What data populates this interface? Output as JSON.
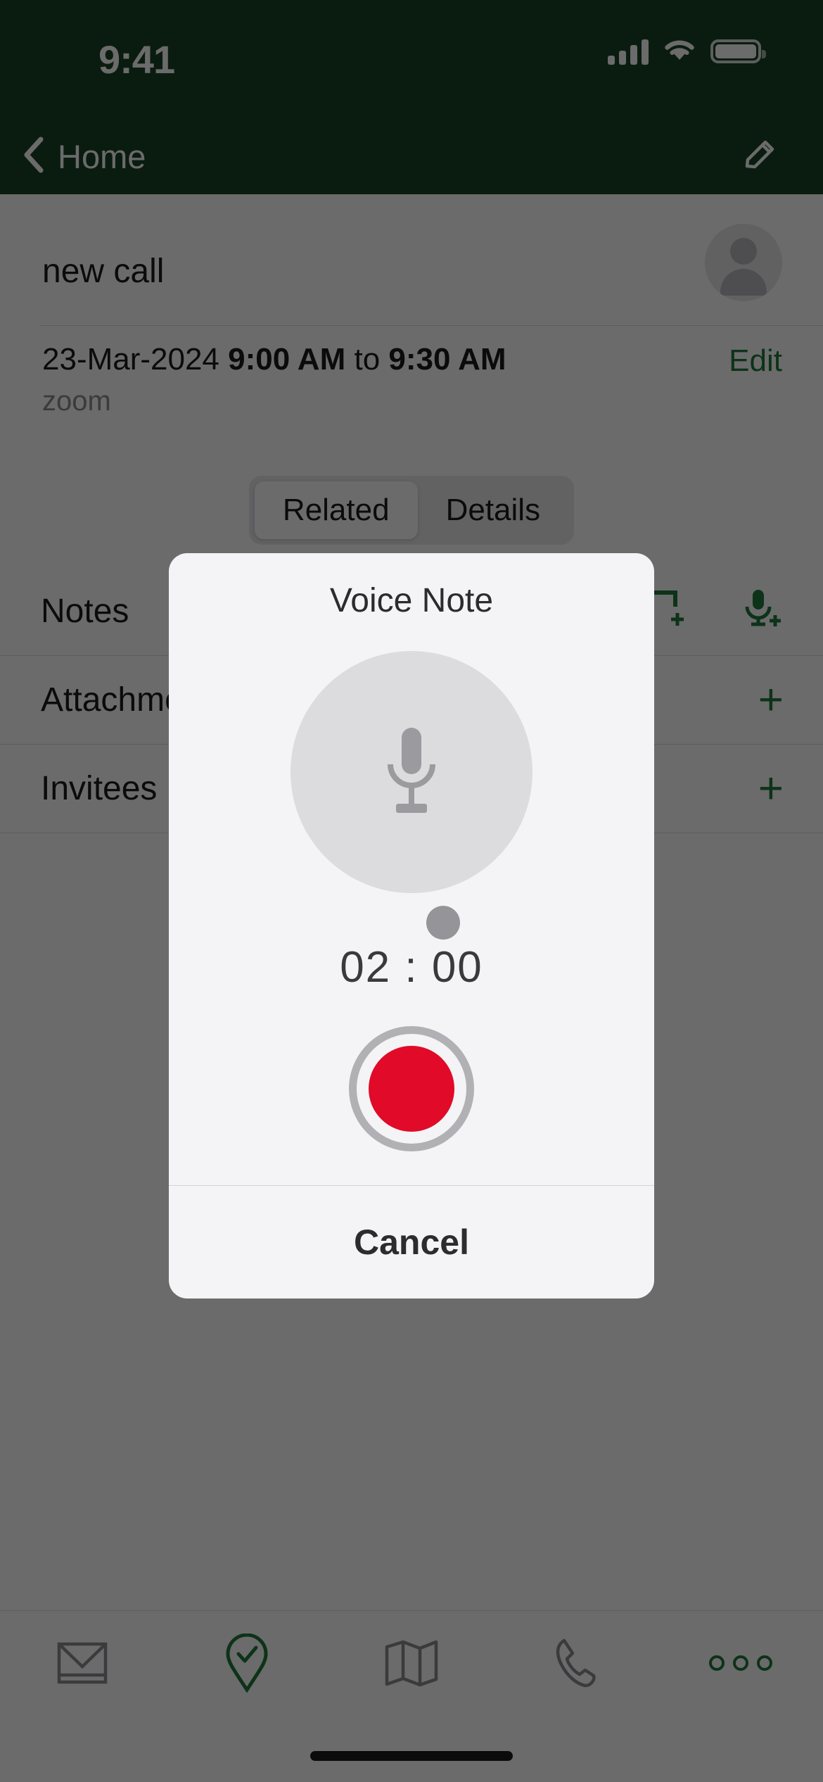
{
  "status_bar": {
    "time": "9:41",
    "icons": [
      "cellular-signal-icon",
      "wifi-icon",
      "battery-icon"
    ]
  },
  "nav_bar": {
    "back_label": "Home",
    "back_icon": "chevron-left-icon",
    "edit_icon": "pencil-icon"
  },
  "record": {
    "title": "new call",
    "avatar_icon": "person-avatar-icon",
    "date": "23-Mar-2024",
    "start_time": "9:00 AM",
    "separator": "to",
    "end_time": "9:30 AM",
    "meeting_type": "zoom",
    "edit_label": "Edit"
  },
  "tabs": [
    {
      "label": "Related",
      "active": true
    },
    {
      "label": "Details",
      "active": false
    }
  ],
  "related_rows": [
    {
      "label": "Notes",
      "actions": [
        {
          "icon": "note-add-icon",
          "label": ""
        },
        {
          "icon": "mic-add-icon",
          "label": ""
        }
      ]
    },
    {
      "label": "Attachments",
      "actions": [
        {
          "icon": "plus-icon",
          "label": "+"
        }
      ]
    },
    {
      "label": "Invitees",
      "actions": [
        {
          "icon": "plus-icon",
          "label": "+"
        }
      ]
    }
  ],
  "tab_bar": [
    {
      "name": "mail-icon",
      "active": false
    },
    {
      "name": "location-check-icon",
      "active": true
    },
    {
      "name": "map-icon",
      "active": false
    },
    {
      "name": "phone-icon",
      "active": false
    },
    {
      "name": "more-dots-icon",
      "active": true
    }
  ],
  "voice_note_modal": {
    "title": "Voice Note",
    "mic_icon": "microphone-icon",
    "timer": "02 : 00",
    "record_button_icon": "record-circle-icon",
    "cancel_label": "Cancel"
  },
  "colors": {
    "brand_green": "#1a4428",
    "accent_green": "#1f7a3d",
    "record_red": "#e10a28",
    "modal_bg": "#f4f4f6",
    "overlay": "rgba(0,0,0,0.58)"
  }
}
